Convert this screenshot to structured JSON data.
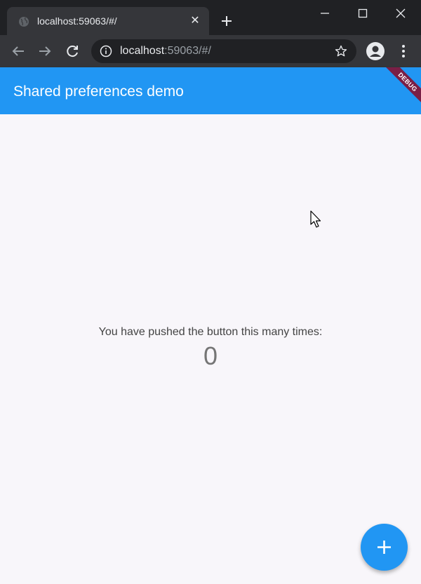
{
  "browser": {
    "tab": {
      "title": "localhost:59063/#/"
    },
    "address": {
      "host": "localhost",
      "rest": ":59063/#/"
    }
  },
  "app": {
    "title": "Shared preferences demo",
    "debug_banner": "DEBUG",
    "message": "You have pushed the button this many times:",
    "counter": "0"
  },
  "colors": {
    "primary": "#2196f3",
    "debug_banner": "#7a1f46",
    "chrome_dark": "#202124",
    "chrome_toolbar": "#35363a"
  },
  "icons": [
    "globe-icon",
    "close-icon",
    "plus-icon",
    "minimize-icon",
    "maximize-icon",
    "window-close-icon",
    "back-arrow-icon",
    "forward-arrow-icon",
    "reload-icon",
    "info-icon",
    "star-icon",
    "profile-icon",
    "more-vert-icon",
    "cursor-icon",
    "add-icon"
  ]
}
